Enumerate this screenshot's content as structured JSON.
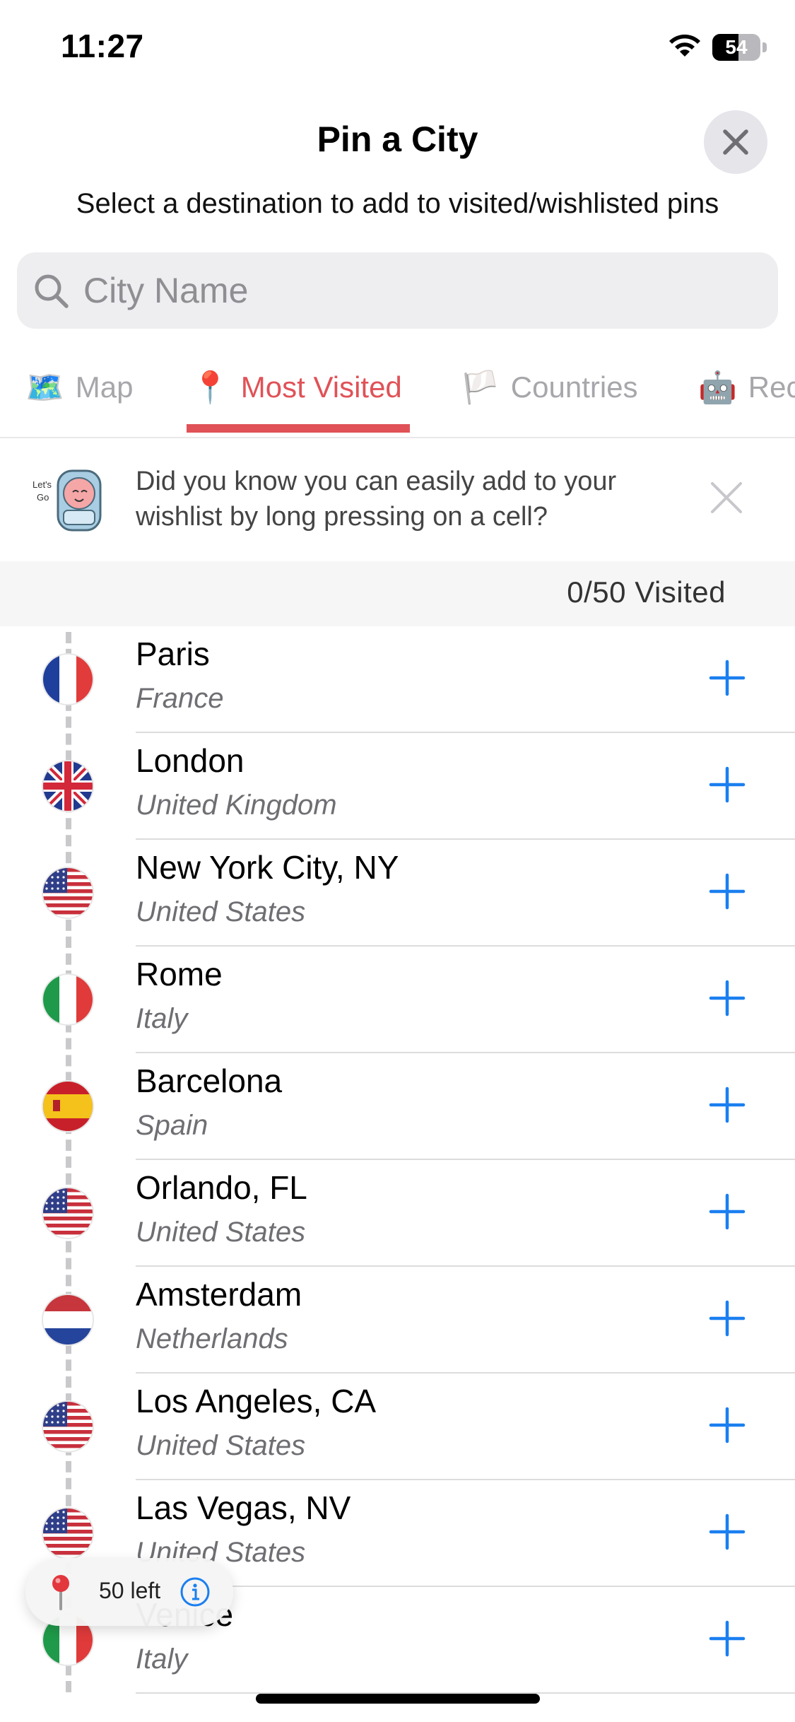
{
  "status_bar": {
    "time": "11:27",
    "battery": "54",
    "battery_fraction": 0.54
  },
  "header": {
    "title": "Pin a City",
    "subtitle": "Select a destination to add to visited/wishlisted pins"
  },
  "search": {
    "placeholder": "City Name",
    "value": ""
  },
  "tabs": [
    {
      "emoji": "🗺️",
      "label": "Map",
      "active": false
    },
    {
      "emoji": "📍",
      "label": "Most Visited",
      "active": true
    },
    {
      "emoji": "🏳️",
      "label": "Countries",
      "active": false
    },
    {
      "emoji": "🤖",
      "label": "Rec",
      "active": false
    }
  ],
  "tip": {
    "mascot_text": "Let's Go",
    "text": "Did you know you can easily add to your wishlist by long pressing on a cell?"
  },
  "visited_counter": "0/50 Visited",
  "cities": [
    {
      "city": "Paris",
      "country": "France",
      "flag": "fr"
    },
    {
      "city": "London",
      "country": "United Kingdom",
      "flag": "gb"
    },
    {
      "city": "New York City, NY",
      "country": "United States",
      "flag": "us"
    },
    {
      "city": "Rome",
      "country": "Italy",
      "flag": "it"
    },
    {
      "city": "Barcelona",
      "country": "Spain",
      "flag": "es"
    },
    {
      "city": "Orlando, FL",
      "country": "United States",
      "flag": "us"
    },
    {
      "city": "Amsterdam",
      "country": "Netherlands",
      "flag": "nl"
    },
    {
      "city": "Los Angeles, CA",
      "country": "United States",
      "flag": "us"
    },
    {
      "city": "Las Vegas, NV",
      "country": "United States",
      "flag": "us"
    },
    {
      "city": "Venice",
      "country": "Italy",
      "flag": "it"
    }
  ],
  "pin_counter": {
    "label": "50 left"
  },
  "colors": {
    "accent": "#e05257",
    "add_blue": "#1a7ff0",
    "tab_inactive": "#a7a7ab"
  }
}
